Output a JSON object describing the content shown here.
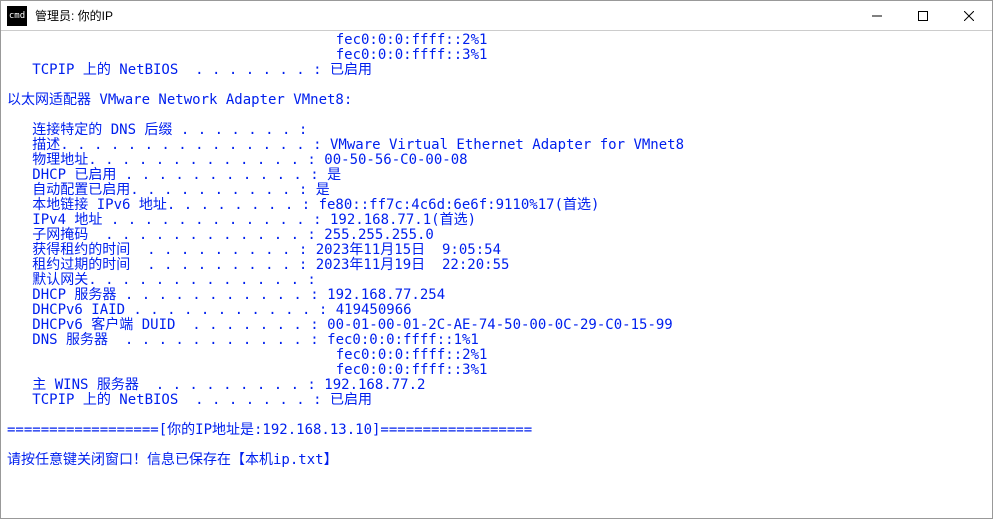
{
  "window": {
    "icon_text": "cmd",
    "title": "管理员: 你的IP"
  },
  "terminal": {
    "lines": [
      "                                       fec0:0:0:ffff::2%1",
      "                                       fec0:0:0:ffff::3%1",
      "   TCPIP 上的 NetBIOS  . . . . . . . : 已启用",
      "",
      "以太网适配器 VMware Network Adapter VMnet8:",
      "",
      "   连接特定的 DNS 后缀 . . . . . . . :",
      "   描述. . . . . . . . . . . . . . . : VMware Virtual Ethernet Adapter for VMnet8",
      "   物理地址. . . . . . . . . . . . . : 00-50-56-C0-00-08",
      "   DHCP 已启用 . . . . . . . . . . . : 是",
      "   自动配置已启用. . . . . . . . . . : 是",
      "   本地链接 IPv6 地址. . . . . . . . : fe80::ff7c:4c6d:6e6f:9110%17(首选)",
      "   IPv4 地址 . . . . . . . . . . . . : 192.168.77.1(首选)",
      "   子网掩码  . . . . . . . . . . . . : 255.255.255.0",
      "   获得租约的时间  . . . . . . . . . : 2023年11月15日  9:05:54",
      "   租约过期的时间  . . . . . . . . . : 2023年11月19日  22:20:55",
      "   默认网关. . . . . . . . . . . . . :",
      "   DHCP 服务器 . . . . . . . . . . . : 192.168.77.254",
      "   DHCPv6 IAID . . . . . . . . . . . : 419450966",
      "   DHCPv6 客户端 DUID  . . . . . . . : 00-01-00-01-2C-AE-74-50-00-0C-29-C0-15-99",
      "   DNS 服务器  . . . . . . . . . . . : fec0:0:0:ffff::1%1",
      "                                       fec0:0:0:ffff::2%1",
      "                                       fec0:0:0:ffff::3%1",
      "   主 WINS 服务器  . . . . . . . . . : 192.168.77.2",
      "   TCPIP 上的 NetBIOS  . . . . . . . : 已启用",
      "",
      "==================[你的IP地址是:192.168.13.10]==================",
      "",
      "请按任意键关闭窗口！信息已保存在【本机ip.txt】"
    ]
  }
}
